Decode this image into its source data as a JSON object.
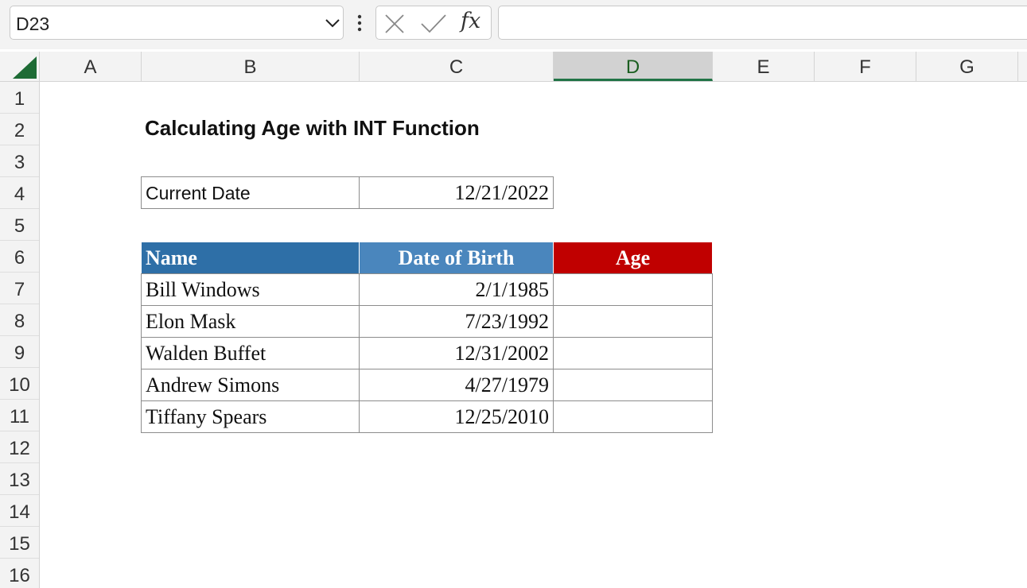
{
  "formula_bar": {
    "name_box": "D23",
    "formula": "",
    "fx_label": "fx"
  },
  "columns": [
    "A",
    "B",
    "C",
    "D",
    "E",
    "F",
    "G"
  ],
  "selected_column": "D",
  "rows": [
    "1",
    "2",
    "3",
    "4",
    "5",
    "6",
    "7",
    "8",
    "9",
    "10",
    "11",
    "12",
    "13",
    "14",
    "15",
    "16"
  ],
  "sheet": {
    "title": "Calculating Age with INT Function",
    "current_date_label": "Current Date",
    "current_date_value": "12/21/2022",
    "table": {
      "headers": [
        "Name",
        "Date of Birth",
        "Age"
      ],
      "header_colors": [
        "#2e6fa7",
        "#4a86bd",
        "#c00000"
      ],
      "rows": [
        {
          "name": "Bill Windows",
          "dob": "2/1/1985",
          "age": ""
        },
        {
          "name": "Elon Mask",
          "dob": "7/23/1992",
          "age": ""
        },
        {
          "name": "Walden Buffet",
          "dob": "12/31/2002",
          "age": ""
        },
        {
          "name": "Andrew Simons",
          "dob": "4/27/1979",
          "age": ""
        },
        {
          "name": "Tiffany Spears",
          "dob": "12/25/2010",
          "age": ""
        }
      ]
    }
  },
  "icons": {
    "name_box_dropdown": "chevron-down-icon",
    "more": "vertical-dots-icon",
    "cancel": "close-icon",
    "enter": "check-icon",
    "select_all": "select-all-triangle-icon"
  }
}
